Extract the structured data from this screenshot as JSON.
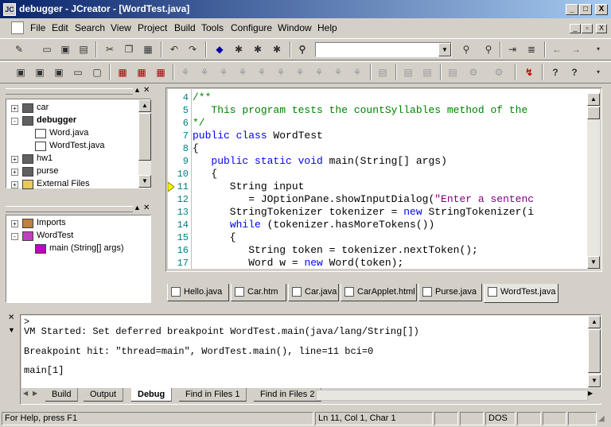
{
  "window": {
    "app_icon": "jc-icon",
    "title": "debugger - JCreator - [WordTest.java]",
    "controls": [
      "_",
      "□",
      "X"
    ]
  },
  "menu": {
    "items": [
      "File",
      "Edit",
      "Search",
      "View",
      "Project",
      "Build",
      "Tools",
      "Configure",
      "Window",
      "Help"
    ],
    "mdi_controls": [
      "_",
      "▫",
      "X"
    ]
  },
  "toolbar": {
    "search_value": ""
  },
  "file_tree": {
    "items": [
      {
        "label": "car",
        "indent": 0,
        "expander": "+",
        "bold": false,
        "icon": "project-icon"
      },
      {
        "label": "debugger",
        "indent": 0,
        "expander": "-",
        "bold": true,
        "icon": "project-icon"
      },
      {
        "label": "Word.java",
        "indent": 1,
        "expander": "",
        "bold": false,
        "icon": "java-file-icon"
      },
      {
        "label": "WordTest.java",
        "indent": 1,
        "expander": "",
        "bold": false,
        "icon": "java-file-icon"
      },
      {
        "label": "hw1",
        "indent": 0,
        "expander": "+",
        "bold": false,
        "icon": "project-icon"
      },
      {
        "label": "purse",
        "indent": 0,
        "expander": "+",
        "bold": false,
        "icon": "project-icon"
      },
      {
        "label": "External Files",
        "indent": 0,
        "expander": "+",
        "bold": false,
        "icon": "folder-icon"
      }
    ]
  },
  "class_tree": {
    "items": [
      {
        "label": "Imports",
        "indent": 0,
        "expander": "+",
        "icon": "imports-icon"
      },
      {
        "label": "WordTest",
        "indent": 0,
        "expander": "-",
        "icon": "class-icon"
      },
      {
        "label": "main (String[] args)",
        "indent": 1,
        "expander": "",
        "icon": "method-icon"
      }
    ]
  },
  "editor": {
    "lines": [
      {
        "n": "4",
        "parts": [
          {
            "t": "/**",
            "c": "cm"
          }
        ]
      },
      {
        "n": "5",
        "parts": [
          {
            "t": "   This program tests the countSyllables method of the",
            "c": "cm"
          }
        ]
      },
      {
        "n": "6",
        "parts": [
          {
            "t": "*/",
            "c": "cm"
          }
        ]
      },
      {
        "n": "7",
        "parts": [
          {
            "t": "public class ",
            "c": "kw"
          },
          {
            "t": "WordTest",
            "c": ""
          }
        ]
      },
      {
        "n": "8",
        "parts": [
          {
            "t": "{",
            "c": ""
          }
        ]
      },
      {
        "n": "9",
        "parts": [
          {
            "t": "   public static void ",
            "c": "kw"
          },
          {
            "t": "main(String[] args)",
            "c": ""
          }
        ]
      },
      {
        "n": "10",
        "parts": [
          {
            "t": "   {",
            "c": ""
          }
        ]
      },
      {
        "n": "11",
        "parts": [
          {
            "t": "      String input",
            "c": ""
          }
        ]
      },
      {
        "n": "12",
        "parts": [
          {
            "t": "         = JOptionPane.showInputDialog(",
            "c": ""
          },
          {
            "t": "\"Enter a sentenc",
            "c": "str"
          }
        ]
      },
      {
        "n": "13",
        "parts": [
          {
            "t": "      StringTokenizer tokenizer = ",
            "c": ""
          },
          {
            "t": "new ",
            "c": "kw"
          },
          {
            "t": "StringTokenizer(i",
            "c": ""
          }
        ]
      },
      {
        "n": "14",
        "parts": [
          {
            "t": "      ",
            "c": ""
          },
          {
            "t": "while ",
            "c": "kw"
          },
          {
            "t": "(tokenizer.hasMoreTokens())",
            "c": ""
          }
        ]
      },
      {
        "n": "15",
        "parts": [
          {
            "t": "      {",
            "c": ""
          }
        ]
      },
      {
        "n": "16",
        "parts": [
          {
            "t": "         String token = tokenizer.nextToken();",
            "c": ""
          }
        ]
      },
      {
        "n": "17",
        "parts": [
          {
            "t": "         Word w = ",
            "c": ""
          },
          {
            "t": "new ",
            "c": "kw"
          },
          {
            "t": "Word(token);",
            "c": ""
          }
        ]
      }
    ],
    "breakpoint_marker_line": "11"
  },
  "file_tabs": [
    {
      "label": "Hello.java",
      "active": false
    },
    {
      "label": "Car.htm",
      "active": false
    },
    {
      "label": "Car.java",
      "active": false
    },
    {
      "label": "CarApplet.html",
      "active": false
    },
    {
      "label": "Purse.java",
      "active": false
    },
    {
      "label": "WordTest.java",
      "active": true
    }
  ],
  "output": {
    "lines": [
      ">",
      "VM Started: Set deferred breakpoint WordTest.main(java/lang/String[])",
      "",
      "Breakpoint hit: \"thread=main\", WordTest.main(), line=11 bci=0",
      "",
      "main[1]"
    ],
    "tabs": [
      {
        "label": "Build",
        "active": false
      },
      {
        "label": "Output",
        "active": false
      },
      {
        "label": "Debug",
        "active": true
      },
      {
        "label": "Find in Files 1",
        "active": false
      },
      {
        "label": "Find in Files 2",
        "active": false
      }
    ]
  },
  "status": {
    "help": "For Help, press F1",
    "position": "Ln 11, Col 1, Char 1",
    "mode": "DOS"
  }
}
